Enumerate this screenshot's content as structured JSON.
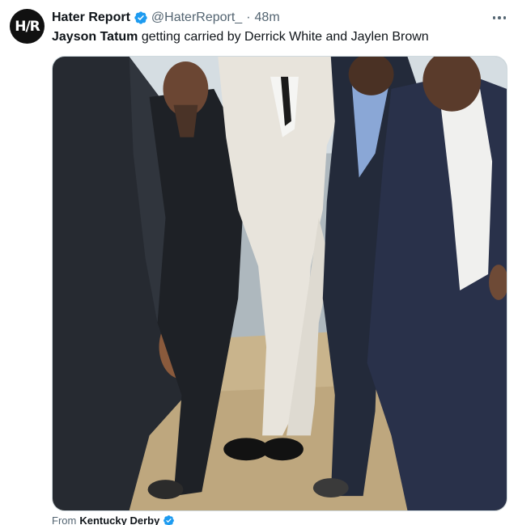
{
  "tweet": {
    "author": {
      "avatar_text": "H/R",
      "display_name": "Hater Report",
      "handle": "@HaterReport_",
      "separator": "·",
      "time": "48m",
      "verified_icon": "verified-badge-icon"
    },
    "text": {
      "bold_part": "Jayson Tatum",
      "rest": " getting carried by Derrick White and Jaylen Brown"
    },
    "media": {
      "type": "photo",
      "icon": "photo"
    },
    "more_icon": "more-horizontal-icon",
    "from": {
      "prefix": "From",
      "source": "Kentucky Derby"
    }
  },
  "colors": {
    "text_primary": "#0f1419",
    "text_secondary": "#536471",
    "verified_blue": "#1d9bf0",
    "border": "#cfd9de"
  }
}
